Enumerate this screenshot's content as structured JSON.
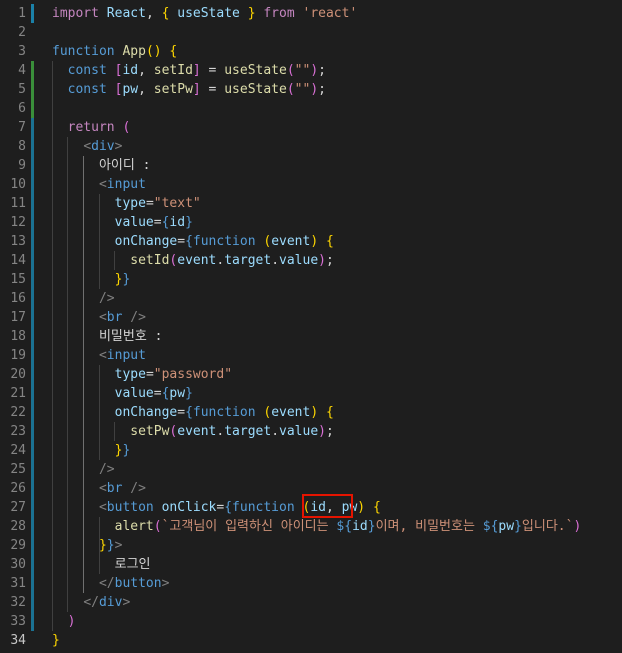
{
  "editor": {
    "language": "javascript-react",
    "colors": {
      "background": "#1e1e1e",
      "line_number": "#858585",
      "added_bar": "#3a8f3a",
      "modified_bar": "#1b81a8",
      "highlight_box": "#e51400"
    },
    "lines": [
      {
        "n": "1",
        "text": "import React, { useState } from 'react'"
      },
      {
        "n": "2",
        "text": ""
      },
      {
        "n": "3",
        "text": "function App() {"
      },
      {
        "n": "4",
        "text": "  const [id, setId] = useState(\"\");"
      },
      {
        "n": "5",
        "text": "  const [pw, setPw] = useState(\"\");"
      },
      {
        "n": "6",
        "text": ""
      },
      {
        "n": "7",
        "text": "  return ("
      },
      {
        "n": "8",
        "text": "    <div>"
      },
      {
        "n": "9",
        "text": "      아이디 :"
      },
      {
        "n": "10",
        "text": "      <input"
      },
      {
        "n": "11",
        "text": "        type=\"text\""
      },
      {
        "n": "12",
        "text": "        value={id}"
      },
      {
        "n": "13",
        "text": "        onChange={function (event) {"
      },
      {
        "n": "14",
        "text": "          setId(event.target.value);"
      },
      {
        "n": "15",
        "text": "        }}"
      },
      {
        "n": "16",
        "text": "      />"
      },
      {
        "n": "17",
        "text": "      <br />"
      },
      {
        "n": "18",
        "text": "      비밀번호 :"
      },
      {
        "n": "19",
        "text": "      <input"
      },
      {
        "n": "20",
        "text": "        type=\"password\""
      },
      {
        "n": "21",
        "text": "        value={pw}"
      },
      {
        "n": "22",
        "text": "        onChange={function (event) {"
      },
      {
        "n": "23",
        "text": "          setPw(event.target.value);"
      },
      {
        "n": "24",
        "text": "        }}"
      },
      {
        "n": "25",
        "text": "      />"
      },
      {
        "n": "26",
        "text": "      <br />"
      },
      {
        "n": "27",
        "text": "      <button onClick={function (id, pw) {"
      },
      {
        "n": "28",
        "text": "        alert(`고객님이 입력하신 아이디는 ${id}이며, 비밀번호는 ${pw}입니다.`)"
      },
      {
        "n": "29",
        "text": "      }}>"
      },
      {
        "n": "30",
        "text": "        로그인"
      },
      {
        "n": "31",
        "text": "      </button>"
      },
      {
        "n": "32",
        "text": "    </div>"
      },
      {
        "n": "33",
        "text": "  )"
      },
      {
        "n": "34",
        "text": "}"
      }
    ]
  }
}
